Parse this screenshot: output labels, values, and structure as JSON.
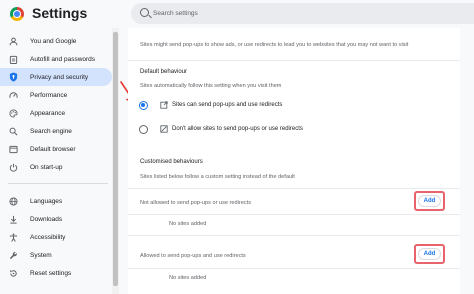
{
  "header": {
    "title": "Settings",
    "search_placeholder": "Search settings"
  },
  "sidebar": {
    "items": [
      {
        "label": "You and Google",
        "icon": "person-icon"
      },
      {
        "label": "Autofill and passwords",
        "icon": "clipboard-icon"
      },
      {
        "label": "Privacy and security",
        "icon": "shield-icon",
        "active": true
      },
      {
        "label": "Performance",
        "icon": "speedometer-icon"
      },
      {
        "label": "Appearance",
        "icon": "palette-icon"
      },
      {
        "label": "Search engine",
        "icon": "search-icon"
      },
      {
        "label": "Default browser",
        "icon": "browser-icon"
      },
      {
        "label": "On start-up",
        "icon": "power-icon"
      },
      {
        "label": "Languages",
        "icon": "globe-icon"
      },
      {
        "label": "Downloads",
        "icon": "download-icon"
      },
      {
        "label": "Accessibility",
        "icon": "accessibility-icon"
      },
      {
        "label": "System",
        "icon": "wrench-icon"
      },
      {
        "label": "Reset settings",
        "icon": "reset-icon"
      }
    ]
  },
  "content": {
    "intro": "Sites might send pop-ups to show ads, or use redirects to lead you to websites that you may not want to visit",
    "default_behaviour": {
      "heading": "Default behaviour",
      "subtitle": "Sites automatically follow this setting when you visit them",
      "options": [
        {
          "label": "Sites can send pop-ups and use redirects",
          "selected": true
        },
        {
          "label": "Don't allow sites to send pop-ups or use redirects",
          "selected": false
        }
      ]
    },
    "customised": {
      "heading": "Customised behaviours",
      "subtitle": "Sites listed below follow a custom setting instead of the default",
      "not_allowed_label": "Not allowed to send pop-ups or use redirects",
      "not_allowed_empty": "No sites added",
      "allowed_label": "Allowed to send pop-ups and use redirects",
      "allowed_empty": "No sites added",
      "add_label": "Add"
    }
  },
  "colors": {
    "accent": "#1a73e8",
    "active_nav_bg": "#d3e3fd",
    "highlight_box": "#e8636b",
    "annotation_arrow": "#e53935"
  }
}
